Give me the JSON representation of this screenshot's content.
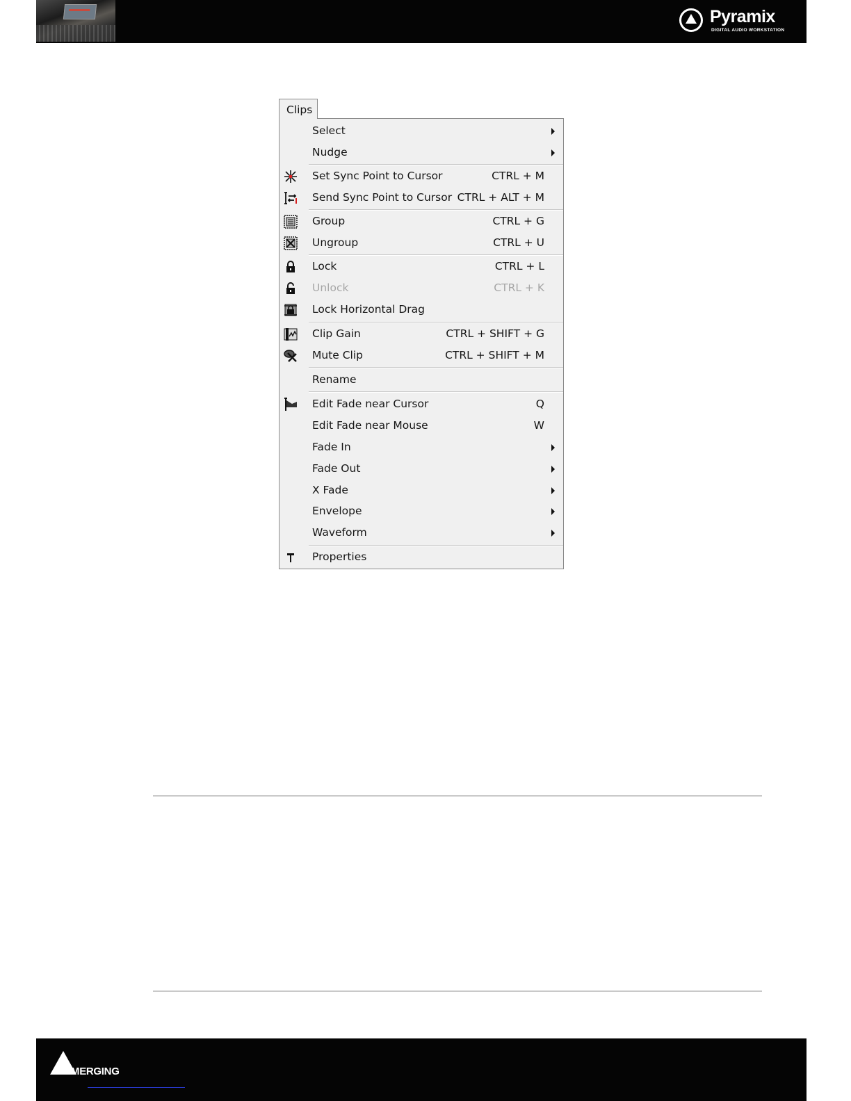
{
  "header": {
    "brand_name": "Pyramix",
    "brand_tagline": "DIGITAL AUDIO WORKSTATION"
  },
  "menu": {
    "title": "Clips",
    "items": [
      {
        "label": "Select",
        "shortcut": "",
        "submenu": true,
        "icon": ""
      },
      {
        "label": "Nudge",
        "shortcut": "",
        "submenu": true,
        "icon": ""
      },
      {
        "label": "Set Sync Point to Cursor",
        "shortcut": "CTRL + M",
        "submenu": false,
        "icon": "sync-point-icon"
      },
      {
        "label": "Send Sync Point to Cursor",
        "shortcut": "CTRL + ALT + M",
        "submenu": false,
        "icon": "send-sync-icon"
      },
      {
        "label": "Group",
        "shortcut": "CTRL + G",
        "submenu": false,
        "icon": "group-icon"
      },
      {
        "label": "Ungroup",
        "shortcut": "CTRL + U",
        "submenu": false,
        "icon": "ungroup-icon"
      },
      {
        "label": "Lock",
        "shortcut": "CTRL + L",
        "submenu": false,
        "icon": "lock-icon"
      },
      {
        "label": "Unlock",
        "shortcut": "CTRL + K",
        "submenu": false,
        "icon": "unlock-icon",
        "disabled": true
      },
      {
        "label": "Lock Horizontal Drag",
        "shortcut": "",
        "submenu": false,
        "icon": "lock-drag-icon"
      },
      {
        "label": "Clip Gain",
        "shortcut": "CTRL + SHIFT + G",
        "submenu": false,
        "icon": "clip-gain-icon"
      },
      {
        "label": "Mute Clip",
        "shortcut": "CTRL + SHIFT + M",
        "submenu": false,
        "icon": "mute-clip-icon"
      },
      {
        "label": "Rename",
        "shortcut": "",
        "submenu": false,
        "icon": ""
      },
      {
        "label": "Edit Fade near Cursor",
        "shortcut": "Q",
        "submenu": false,
        "icon": "edit-fade-icon"
      },
      {
        "label": "Edit Fade near Mouse",
        "shortcut": "W",
        "submenu": false,
        "icon": ""
      },
      {
        "label": "Fade In",
        "shortcut": "",
        "submenu": true,
        "icon": ""
      },
      {
        "label": "Fade Out",
        "shortcut": "",
        "submenu": true,
        "icon": ""
      },
      {
        "label": "X Fade",
        "shortcut": "",
        "submenu": true,
        "icon": ""
      },
      {
        "label": "Envelope",
        "shortcut": "",
        "submenu": true,
        "icon": ""
      },
      {
        "label": "Waveform",
        "shortcut": "",
        "submenu": true,
        "icon": ""
      },
      {
        "label": "Properties",
        "shortcut": "",
        "submenu": false,
        "icon": "properties-icon"
      }
    ]
  },
  "footer": {
    "brand_name": "MERGING"
  }
}
